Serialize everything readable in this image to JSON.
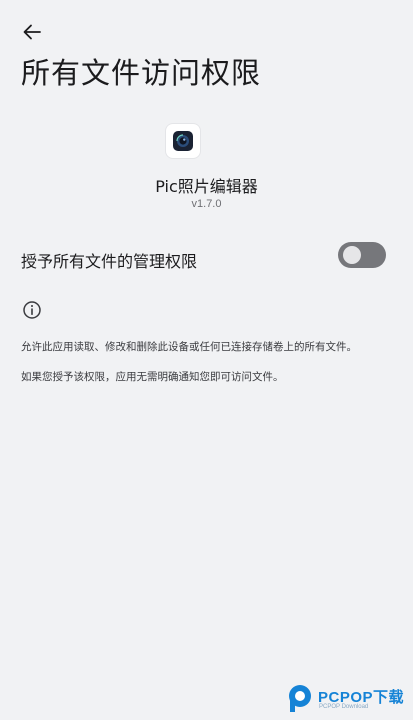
{
  "header": {
    "back_icon": "arrow-left-icon",
    "title": "所有文件访问权限"
  },
  "app": {
    "icon": "app-camera-icon",
    "name": "Pic照片编辑器",
    "version": "v1.7.0"
  },
  "permission": {
    "label": "授予所有文件的管理权限",
    "enabled": false,
    "toggle_track_color": "#76777b",
    "toggle_knob_color": "#e6e6e8"
  },
  "info": {
    "icon": "info-icon",
    "lines": [
      "允许此应用读取、修改和删除此设备或任何已连接存储卷上的所有文件。",
      "如果您授予该权限，应用无需明确通知您即可访问文件。"
    ]
  },
  "watermark": {
    "logo": "pcpop-logo-icon",
    "title": "PCPOP下载",
    "subtitle": "PCPOP Download",
    "color": "#1583d6"
  }
}
